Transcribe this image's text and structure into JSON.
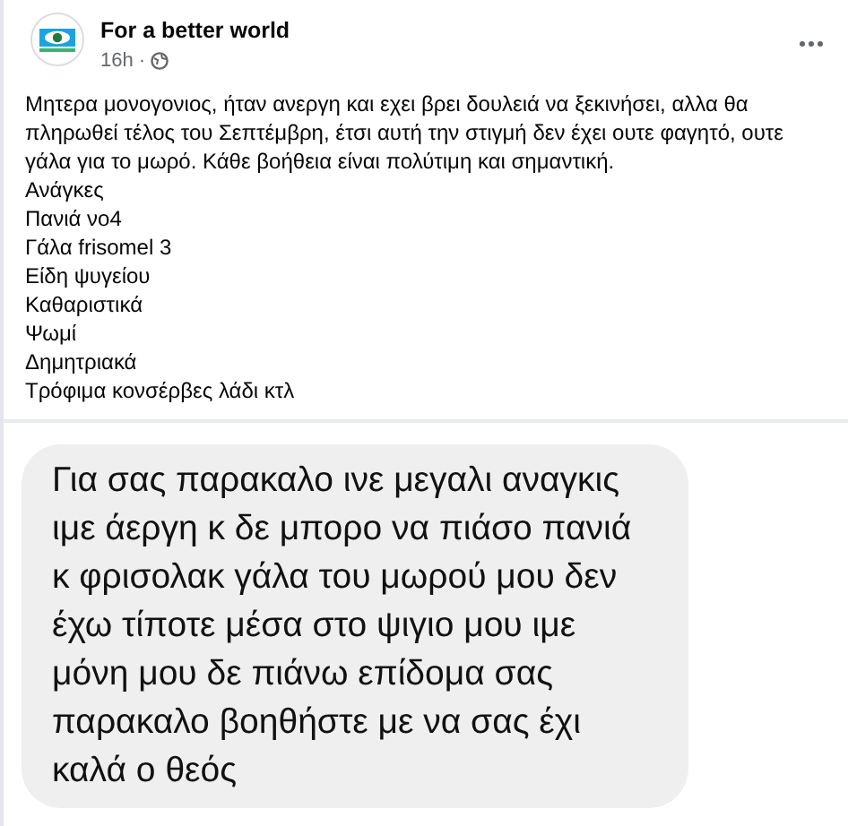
{
  "post": {
    "author": "For a better world",
    "time": "16h ·",
    "text": "Μητερα μονογονιος, ήταν ανεργη και εχει βρει δουλειά να ξεκινήσει, αλλα θα πληρωθεί τέλος του Σεπτέμβρη, έτσι αυτή την στιγμή δεν έχει ουτε φαγητό, ουτε γάλα για το μωρό. Κάθε βοήθεια είναι πολύτιμη και σημαντική.",
    "lines": [
      "Ανάγκες",
      "Πανιά νο4",
      "Γάλα frisomel 3",
      "Είδη ψυγείου",
      "Καθαριστικά",
      "Ψωμί",
      "Δημητριακά",
      "Τρόφιμα κονσέρβες λάδι κτλ"
    ]
  },
  "message": {
    "text": "Για σας παρακαλο ινε μεγαλι αναγκις ιμε άεργη κ δε μπορο να πιάσο πανιά κ φρισολακ γάλα του μωρού μου δεν έχω τίποτε μέσα στο ψιγιο μου ιμε μόνη μου δε πιάνω επίδομα σας παρακαλο βοηθήστε με να σας έχι καλά ο θεός"
  }
}
